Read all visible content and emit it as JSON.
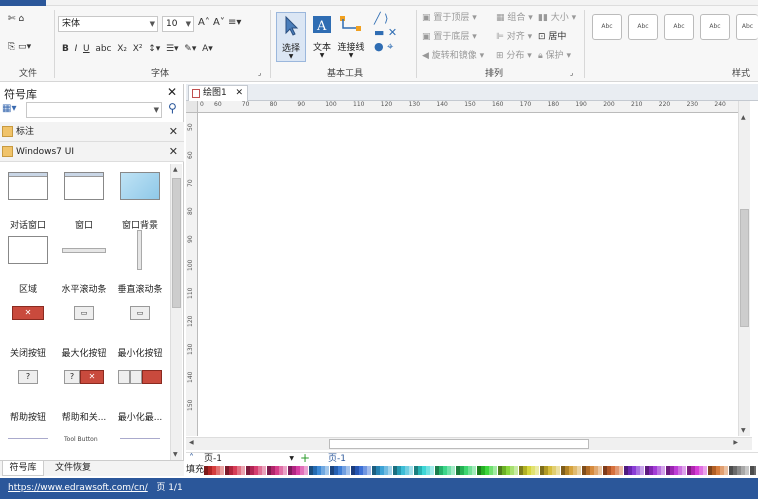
{
  "ribbon": {
    "file_group": {
      "label": "文件"
    },
    "font_group": {
      "font_name": "宋体",
      "font_size": "10",
      "label": "字体"
    },
    "tools_group": {
      "select": "选择",
      "text": "文本",
      "connector": "连接线",
      "label": "基本工具"
    },
    "arrange_group": {
      "bring_top": "置于顶层",
      "send_bottom": "置于底层",
      "rotate_mirror": "旋转和镜像",
      "group": "组合",
      "align": "对齐",
      "distribute": "分布",
      "size": "大小",
      "center": "居中",
      "protect": "保护",
      "label": "排列"
    },
    "styles_group": {
      "box_text": "Abc",
      "label": "样式"
    }
  },
  "symbols_panel": {
    "title": "符号库",
    "search_placeholder": "",
    "lib1": "标注",
    "lib2": "Windows7  UI",
    "shapes": [
      {
        "label": "对话窗口",
        "icon": "dialog-window-icon"
      },
      {
        "label": "窗口",
        "icon": "window-icon"
      },
      {
        "label": "窗口背景",
        "icon": "window-background-icon"
      },
      {
        "label": "区域",
        "icon": "region-icon"
      },
      {
        "label": "水平滚动条",
        "icon": "horizontal-scrollbar-icon"
      },
      {
        "label": "垂直滚动条",
        "icon": "vertical-scrollbar-icon"
      },
      {
        "label": "关闭按钮",
        "icon": "close-button-icon"
      },
      {
        "label": "最大化按钮",
        "icon": "maximize-button-icon"
      },
      {
        "label": "最小化按钮",
        "icon": "minimize-button-icon"
      },
      {
        "label": "帮助按钮",
        "icon": "help-button-icon"
      },
      {
        "label": "帮助和关...",
        "icon": "help-close-button-icon"
      },
      {
        "label": "最小化最...",
        "icon": "min-max-button-icon"
      }
    ],
    "partial_label": "Tool Button",
    "bottom_tabs": [
      "符号库",
      "文件恢复"
    ]
  },
  "canvas": {
    "tab_title": "绘图1",
    "hruler_ticks": [
      "0",
      "60",
      "70",
      "80",
      "90",
      "100",
      "110",
      "120",
      "130",
      "140",
      "150",
      "160",
      "170",
      "180",
      "190",
      "200",
      "210",
      "220",
      "230",
      "240"
    ],
    "vruler_ticks": [
      "50",
      "60",
      "70",
      "80",
      "90",
      "100",
      "110",
      "120",
      "130",
      "140",
      "150"
    ]
  },
  "pagebar": {
    "page_select": "页-1",
    "page_tab": "页-1"
  },
  "colorbar": {
    "label": "填充"
  },
  "status": {
    "url": "https://www.edrawsoft.com/cn/",
    "page": "页 1/1"
  }
}
